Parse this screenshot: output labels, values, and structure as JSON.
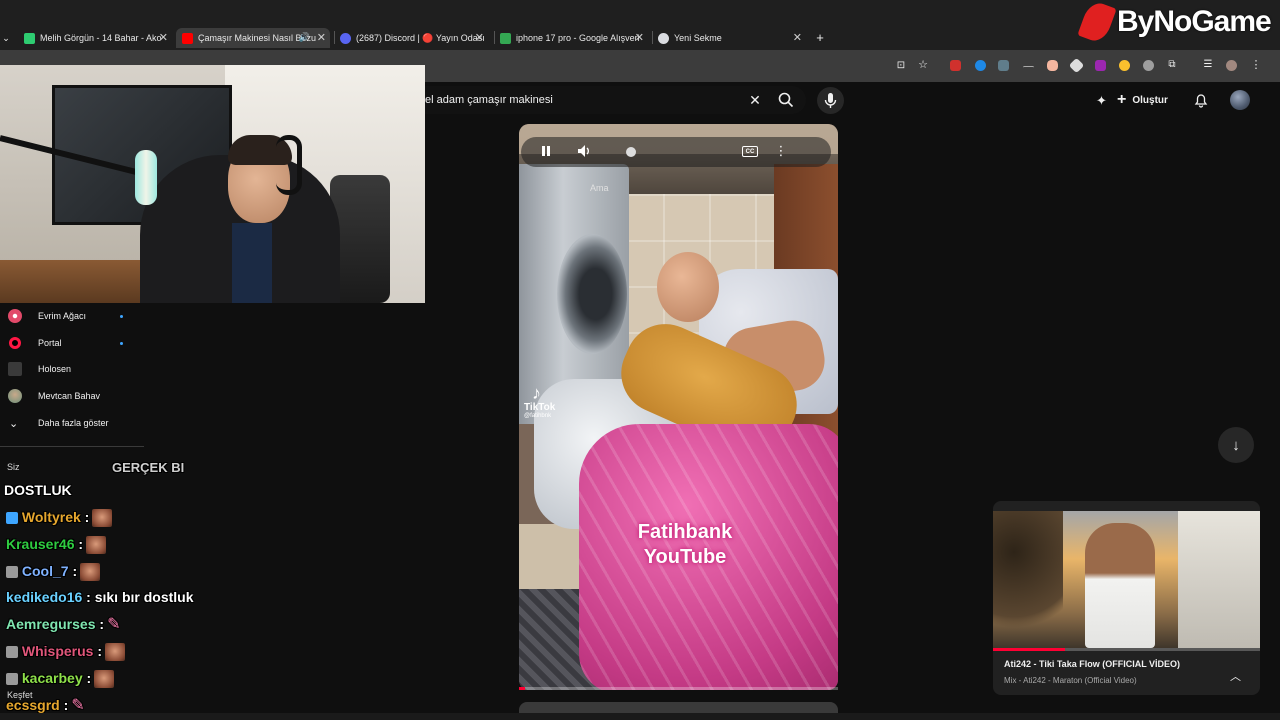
{
  "browser": {
    "tabs": [
      {
        "title": "Melih Görgün - 14 Bahar - Ako",
        "favicon_color": "#2ecc71"
      },
      {
        "title": "Çamaşır Makinesi Nasıl Bozu",
        "favicon_color": "#ff0000",
        "active": true
      },
      {
        "title": "(2687) Discord | 🔴 Yayın Odası",
        "favicon_color": "#5865f2"
      },
      {
        "title": "iphone 17 pro - Google Alışveri",
        "favicon_color": "#34a853"
      },
      {
        "title": "Yeni Sekme",
        "favicon_color": "#dadce0"
      }
    ],
    "new_tab": "+",
    "tab_close": "✕"
  },
  "youtube": {
    "search_query": "el adam çamaşır makinesi",
    "create_label": "Oluştur",
    "sidebar": [
      {
        "label": "Evrim Ağacı",
        "icon_color": "#e24a6a",
        "live_dot": true
      },
      {
        "label": "Portal",
        "icon_color": "#ff1744",
        "live_dot": true
      },
      {
        "label": "Holosen",
        "icon_color": "#3a3a3a",
        "live_dot": false
      },
      {
        "label": "Mevtcan Bahav",
        "icon_color": "#6b8f7a",
        "live_dot": false
      },
      {
        "label": "Daha fazla göster",
        "icon": "chevron-down-icon",
        "live_dot": false
      }
    ],
    "short": {
      "caption_word": "Ama",
      "cc_label": "CC",
      "tiktok_label": "TikTok",
      "tiktok_handle": "@fatihbnk",
      "overlay_line1": "Fatihbank",
      "overlay_line2": "YouTube",
      "progress": 0.02
    },
    "mini_player": {
      "title": "Ati242 - Tiki Taka Flow (OFFICIAL VİDEO)",
      "subtitle": "Mix - Ati242 - Maraton (Official Video)",
      "progress": 0.27
    }
  },
  "chat": {
    "messages": [
      {
        "user": "Woltyrek",
        "color": "#e6a72e",
        "text": ":",
        "emote": "face"
      },
      {
        "user": "Krauser46",
        "color": "#2ecc40",
        "text": ":",
        "emote": "face"
      },
      {
        "user": "Cool_7",
        "color": "#7fb2ff",
        "text": ":",
        "emote": "face"
      },
      {
        "user": "kedikedo16",
        "color": "#6ad1ff",
        "text": ": sıkı bır dostluk",
        "emote": ""
      },
      {
        "user": "Aemregurses",
        "color": "#7fe6b0",
        "text": ":",
        "emote": "pink"
      },
      {
        "user": "Whisperus",
        "color": "#e0567a",
        "text": ":",
        "emote": "face"
      },
      {
        "user": "kacarbey",
        "color": "#8ee04a",
        "text": ":",
        "emote": "face"
      },
      {
        "user": "ecssgrd",
        "color": "#e6a72e",
        "text": ":",
        "emote": "pink"
      }
    ],
    "overflow_line": "DOSTLUK",
    "overflow_top": "GERÇEK BI",
    "ghost_siz": "Siz",
    "ghost_kesfet": "Keşfet"
  },
  "brand": {
    "name": "ByNoGame"
  }
}
